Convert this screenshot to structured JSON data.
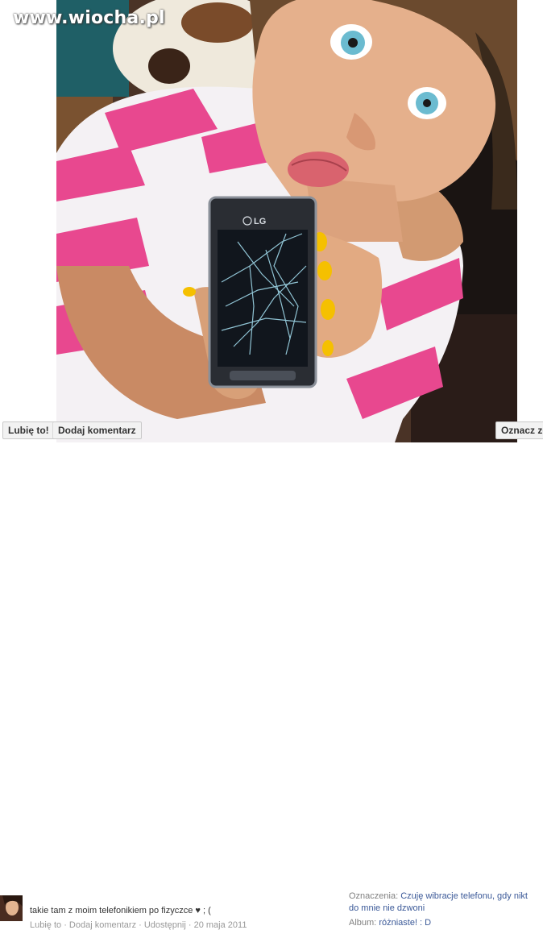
{
  "watermark": "www.wiocha.pl",
  "photo": {
    "phone_brand": "LG"
  },
  "actions": {
    "like_label": "Lubię to!",
    "comment_label": "Dodaj komentarz",
    "tag_label": "Oznacz zdjęcie"
  },
  "post": {
    "caption": "takie tam z moim telefonikiem po fizyczce ♥ ; (",
    "meta": "Lubię to · Dodaj komentarz · Udostępnij · 20 maja 2011"
  },
  "tags": {
    "prefix": "Oznaczenia:",
    "link": "Czuję wibracje telefonu, gdy nikt do mnie nie dzwoni"
  },
  "album": {
    "prefix": "Album:",
    "link": "różniaste! : D"
  },
  "colors": {
    "link": "#3b5998",
    "stripe_pink": "#e8488f",
    "nails": "#f5c000",
    "eyes": "#6bbbd0"
  }
}
